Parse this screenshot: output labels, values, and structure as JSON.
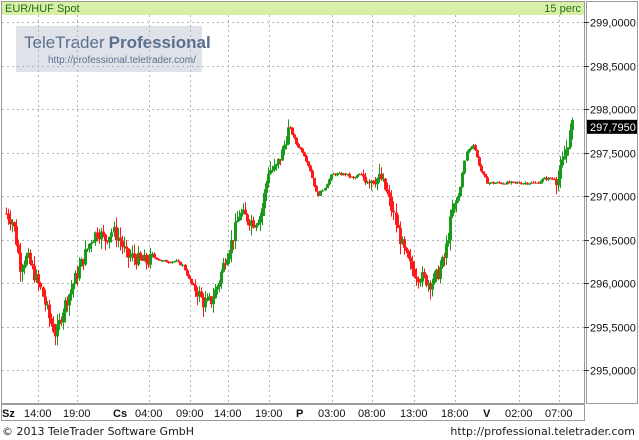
{
  "header": {
    "instrument": "EUR/HUF Spot",
    "interval": "15 perc"
  },
  "watermark": {
    "brand_plain": "TeleTrader",
    "brand_bold": "Professional",
    "url": "http://professional.teletrader.com/"
  },
  "footer": {
    "copyright": "© 2013 TeleTrader Software GmbH",
    "url": "http://professional.teletrader.com"
  },
  "colors": {
    "up": "#1a9a1a",
    "down": "#ff1a1a",
    "title_bg": "#d9efa6",
    "grid": "#b5b5b5",
    "last_price_bg": "#000000"
  },
  "chart_data": {
    "type": "candlestick",
    "title": "EUR/HUF Spot",
    "interval": "15 perc",
    "ylim": [
      294.6,
      299.2
    ],
    "y_ticks": [
      "299,0000",
      "298,5000",
      "298,0000",
      "297,5000",
      "297,0000",
      "296,5000",
      "296,0000",
      "295,5000",
      "295,0000"
    ],
    "last_price": "297,7950",
    "last_price_value": 297.795,
    "x_labels": [
      {
        "day": "Sz",
        "time": "14:00"
      },
      {
        "day": "",
        "time": "19:00"
      },
      {
        "day": "Cs",
        "time": "04:00"
      },
      {
        "day": "",
        "time": "09:00"
      },
      {
        "day": "",
        "time": "14:00"
      },
      {
        "day": "",
        "time": "19:00"
      },
      {
        "day": "P",
        "time": "03:00"
      },
      {
        "day": "",
        "time": "08:00"
      },
      {
        "day": "",
        "time": "13:00"
      },
      {
        "day": "",
        "time": "18:00"
      },
      {
        "day": "V",
        "time": "02:00"
      },
      {
        "day": "",
        "time": "07:00"
      }
    ],
    "close_path": [
      296.8,
      296.7,
      296.2,
      296.3,
      296.1,
      295.9,
      295.6,
      295.4,
      295.7,
      295.9,
      296.1,
      296.3,
      296.5,
      296.6,
      296.5,
      296.6,
      296.5,
      296.3,
      296.3,
      296.25,
      296.25,
      296.3,
      296.25,
      296.25,
      296.25,
      296.2,
      296.0,
      295.9,
      295.75,
      295.8,
      296.0,
      296.3,
      296.5,
      296.8,
      296.75,
      296.7,
      296.8,
      297.3,
      297.3,
      297.5,
      297.8,
      297.6,
      297.5,
      297.3,
      297.0,
      297.1,
      297.25,
      297.25,
      297.25,
      297.2,
      297.25,
      297.2,
      297.2,
      297.2,
      297.0,
      296.7,
      296.4,
      296.2,
      296.1,
      296.05,
      296.0,
      296.1,
      296.3,
      296.8,
      297.0,
      297.5,
      297.6,
      297.3,
      297.15,
      297.15,
      297.15,
      297.15,
      297.15,
      297.15,
      297.15,
      297.15,
      297.2,
      297.2,
      297.2,
      297.5,
      297.8
    ]
  }
}
